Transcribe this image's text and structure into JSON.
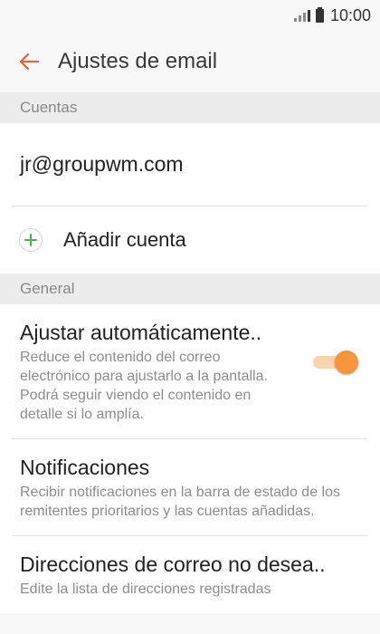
{
  "status_bar": {
    "time": "10:00"
  },
  "app_bar": {
    "title": "Ajustes de email"
  },
  "sections": {
    "accounts_header": "Cuentas",
    "general_header": "General"
  },
  "accounts": {
    "email": "jr@groupwm.com",
    "add_label": "Añadir cuenta"
  },
  "settings": [
    {
      "title": "Ajustar automáticamente..",
      "subtitle": "Reduce el contenido del correo electrónico para ajustarlo a la pantalla. Podrá seguir viendo el contenido en detalle si lo amplía.",
      "toggle_on": true
    },
    {
      "title": "Notificaciones",
      "subtitle": "Recibir notificaciones en la barra de estado de los remitentes prioritarios y las cuentas añadidas."
    },
    {
      "title": "Direcciones de correo no desea..",
      "subtitle": "Edite la lista de direcciones registradas"
    }
  ],
  "colors": {
    "accent": "#f7953a",
    "back_arrow": "#e8603c",
    "add_icon": "#4caf50"
  },
  "icons": [
    "signal-icon",
    "battery-icon",
    "back-arrow-icon",
    "add-icon"
  ]
}
